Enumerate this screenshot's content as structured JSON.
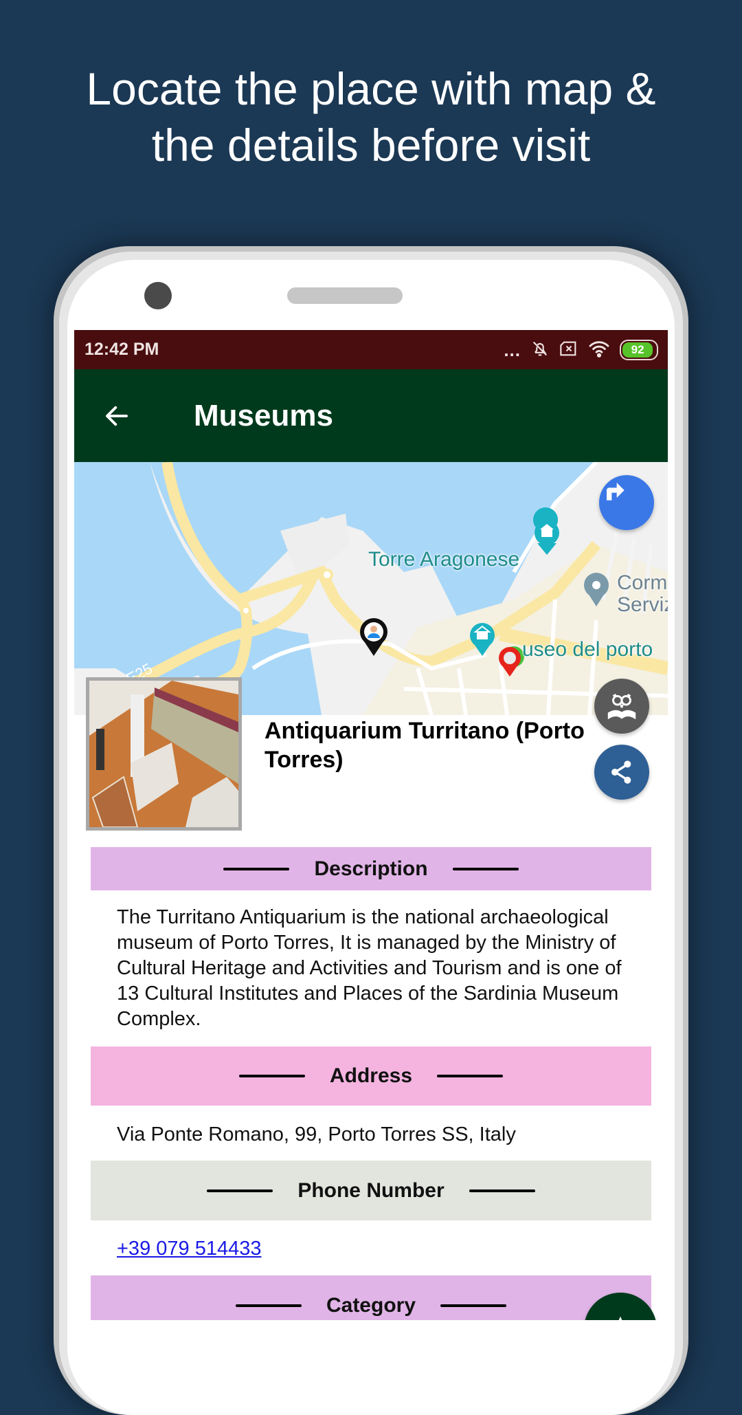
{
  "headline": {
    "line1": "Locate the place with map &",
    "line2": "the details before visit"
  },
  "status_bar": {
    "time": "12:42 PM",
    "overflow": "...",
    "icons": [
      "notifications-muted-icon",
      "sim-none-icon",
      "wifi-icon",
      "battery-icon"
    ],
    "battery_level": "92",
    "battery_fraction": 0.92
  },
  "app_bar": {
    "back_icon": "arrow-left-icon",
    "title": "Museums"
  },
  "map": {
    "labels": {
      "torre": "Torre Aragonese",
      "corm_line1": "Corm",
      "corm_line2": "Serviz",
      "museo": "useo del porto",
      "road": "E25"
    },
    "buttons": {
      "directions_icon": "turn-right-icon"
    }
  },
  "place": {
    "title": "Antiquarium Turritano (Porto Torres)",
    "photo_alt": "Museum interior photo"
  },
  "actions": {
    "guide_icon": "owl-book-icon",
    "share_icon": "share-icon",
    "favorite_icon": "star-icon"
  },
  "sections": {
    "description": {
      "heading": "Description",
      "text": "The Turritano Antiquarium is the national archaeological museum of Porto Torres, It is managed by the Ministry of Cultural Heritage and Activities and Tourism and is one of 13 Cultural Institutes and Places of the Sardinia Museum Complex."
    },
    "address": {
      "heading": "Address",
      "text": "Via Ponte Romano, 99, Porto Torres SS, Italy"
    },
    "phone": {
      "heading": "Phone Number",
      "text": "+39 079 514433"
    },
    "category": {
      "heading": "Category"
    }
  },
  "colors": {
    "background": "#1b3854",
    "status_bar": "#4a0d0f",
    "app_bar": "#003a1c",
    "description_band": "#e0b4e6",
    "address_band": "#f4b4df",
    "phone_band": "#e2e4de",
    "category_band": "#e0b4e6",
    "link": "#1a1ae6",
    "directions_fab": "#3b78e7",
    "guide_fab": "#5a5a5a",
    "share_fab": "#2e5f95",
    "favorite_fab": "#003a1c"
  }
}
